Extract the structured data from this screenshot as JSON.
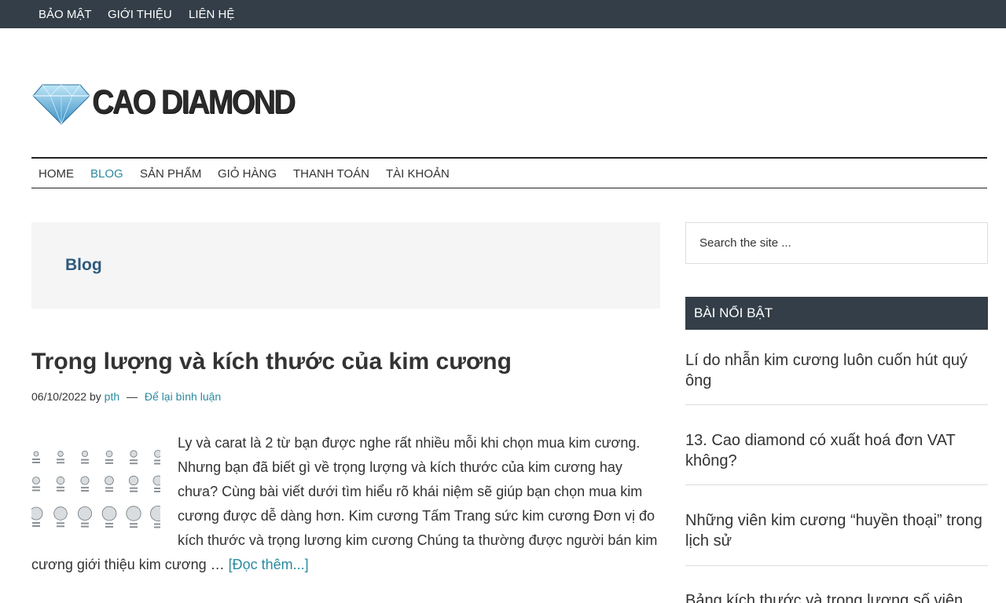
{
  "top_nav": [
    "BẢO MẬT",
    "GIỚI THIỆU",
    "LIÊN HỆ"
  ],
  "logo": {
    "text": "CAO DIAMOND"
  },
  "main_nav": {
    "items": [
      "HOME",
      "BLOG",
      "SẢN PHẨM",
      "GIỎ HÀNG",
      "THANH TOÁN",
      "TÀI KHOẢN"
    ],
    "active": "BLOG"
  },
  "archive": {
    "title": "Blog"
  },
  "post": {
    "title": "Trọng lượng và kích thước của kim cương",
    "date": "06/10/2022",
    "by": "by",
    "author": "pth",
    "dash": "—",
    "comments": "Để lại bình luận",
    "excerpt": "Ly và carat là 2 từ bạn được nghe rất nhiều mỗi khi chọn mua kim cương. Nhưng bạn đã biết gì về trọng lượng và kích thước của kim cương hay chưa? Cùng bài viết dưới tìm hiểu rõ khái niệm sẽ giúp bạn chọn mua kim cương được dễ dàng hơn. Kim cương Tấm Trang sức kim cương Đơn vị đo kích thước và trọng lương kim cương Chúng ta thường được người bán kim cương giới thiệu kim cương … ",
    "read_more": "[Đọc thêm...]"
  },
  "sidebar": {
    "search_placeholder": "Search the site ...",
    "widget_title": "BÀI NỔI BẬT",
    "featured": [
      "Lí do nhẫn kim cương luôn cuốn hút quý ông",
      "13. Cao diamond có xuất hoá đơn VAT không?",
      "Những viên kim cương “huyền thoại” trong lịch sử",
      "Bảng kích thước và trọng lượng số viên"
    ]
  },
  "colors": {
    "topbar": "#333e48",
    "accent": "#2b8a9e",
    "archive_title": "#2d5a7e",
    "archive_bg": "#f5f5f5"
  }
}
